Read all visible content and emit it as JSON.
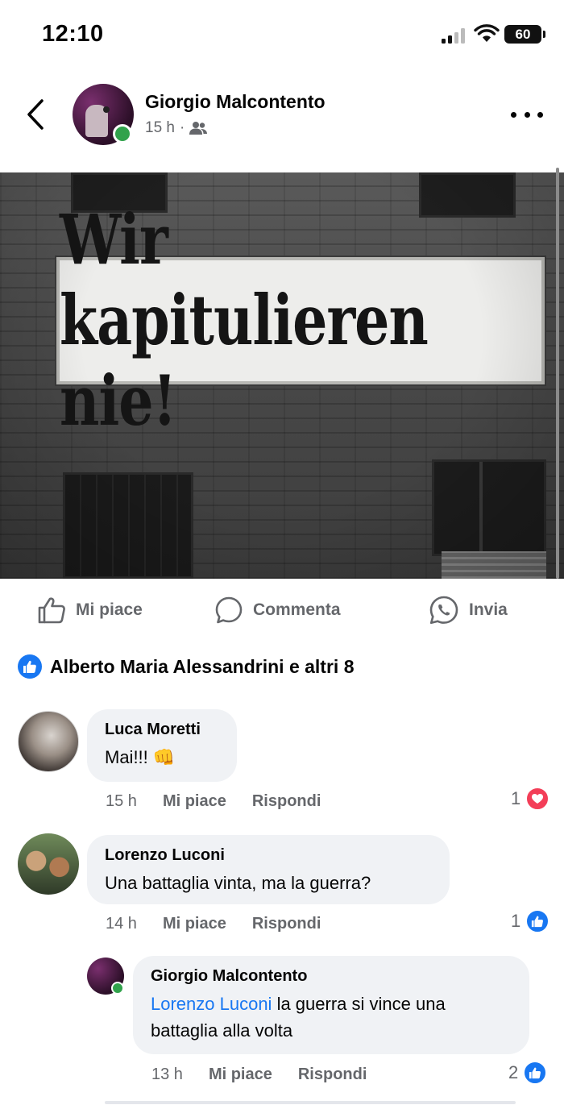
{
  "status_bar": {
    "time": "12:10",
    "battery": "60"
  },
  "post": {
    "author": "Giorgio Malcontento",
    "time": "15 h",
    "meta_separator": "·",
    "audience_icon": "friends-icon",
    "image_banner_text": "Wir kapitulieren nie!"
  },
  "actions": {
    "like_label": "Mi piace",
    "comment_label": "Commenta",
    "share_label": "Invia"
  },
  "reactions": {
    "summary": "Alberto Maria Alessandrini e altri 8"
  },
  "comments": [
    {
      "author": "Luca Moretti",
      "text": "Mai!!! 👊",
      "time": "15 h",
      "like_label": "Mi piace",
      "reply_label": "Rispondi",
      "reaction_count": "1",
      "reaction_type": "heart"
    },
    {
      "author": "Lorenzo Luconi",
      "text": "Una battaglia vinta, ma la guerra?",
      "time": "14 h",
      "like_label": "Mi piace",
      "reply_label": "Rispondi",
      "reaction_count": "1",
      "reaction_type": "like"
    },
    {
      "author": "Giorgio Malcontento",
      "mention": "Lorenzo Luconi",
      "text": " la guerra si vince una battaglia alla volta",
      "time": "13 h",
      "like_label": "Mi piace",
      "reply_label": "Rispondi",
      "reaction_count": "2",
      "reaction_type": "like"
    }
  ],
  "colors": {
    "accent": "#1877f2",
    "online": "#31a24c",
    "heart": "#f33e58",
    "secondary_text": "#65676b",
    "bubble": "#f0f2f5"
  }
}
